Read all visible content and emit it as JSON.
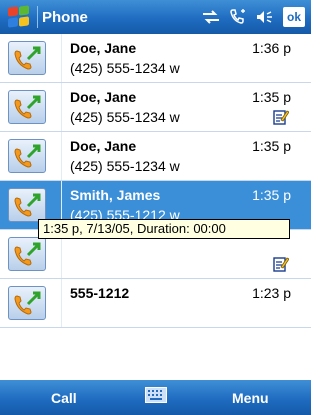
{
  "titlebar": {
    "title": "Phone",
    "ok_label": "ok",
    "icons": [
      "start-menu-icon",
      "connectivity-icon",
      "phone-signal-icon",
      "volume-icon"
    ]
  },
  "call_log": [
    {
      "name": "Doe, Jane",
      "number": "(425) 555-1234 w",
      "time": "1:36 p",
      "has_note": false,
      "selected": false
    },
    {
      "name": "Doe, Jane",
      "number": "(425) 555-1234 w",
      "time": "1:35 p",
      "has_note": true,
      "selected": false
    },
    {
      "name": "Doe, Jane",
      "number": "(425) 555-1234 w",
      "time": "1:35 p",
      "has_note": false,
      "selected": false
    },
    {
      "name": "Smith, James",
      "number": "(425) 555-1212 w",
      "time": "1:35 p",
      "has_note": false,
      "selected": true
    },
    {
      "name": "",
      "number": "",
      "time": "",
      "has_note": true,
      "selected": false
    },
    {
      "name": "555-1212",
      "number": "",
      "time": "1:23 p",
      "has_note": false,
      "selected": false
    }
  ],
  "tooltip": {
    "text": "1:35 p, 7/13/05, Duration: 00:00"
  },
  "menubar": {
    "left_softkey": "Call",
    "right_softkey": "Menu",
    "center_icon": "keyboard-icon"
  },
  "colors": {
    "bar_blue": "#1f6cc1",
    "selection_blue": "#3a8fd8",
    "tooltip_bg": "#ffffe1"
  }
}
